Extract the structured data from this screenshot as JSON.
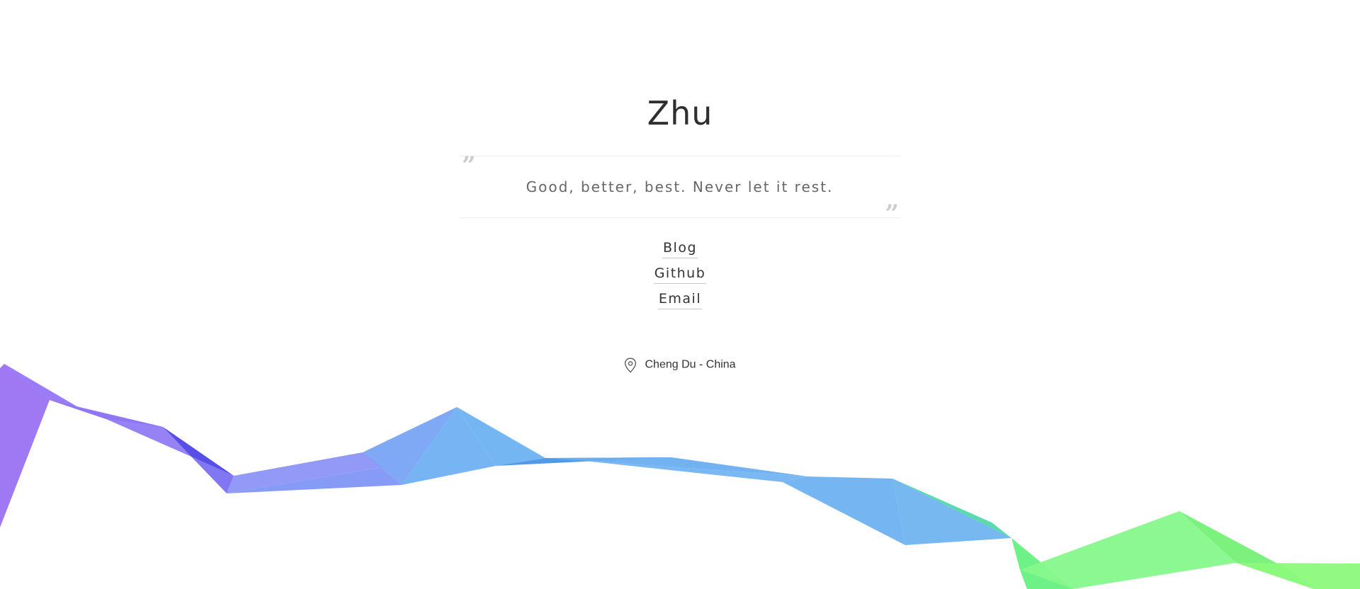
{
  "header": {
    "title": "Zhu"
  },
  "quote": {
    "open_mark": "”",
    "close_mark": "”",
    "text": "Good, better, best. Never let it rest."
  },
  "links": [
    {
      "label": "Blog"
    },
    {
      "label": "Github"
    },
    {
      "label": "Email"
    }
  ],
  "location": {
    "icon": "map-pin-icon",
    "text": "Cheng Du - China"
  },
  "colors": {
    "ribbon_purple": "#9b7cf6",
    "ribbon_indigo": "#5a4ee8",
    "ribbon_blue": "#6fb0f2",
    "ribbon_green": "#7ef57a"
  }
}
